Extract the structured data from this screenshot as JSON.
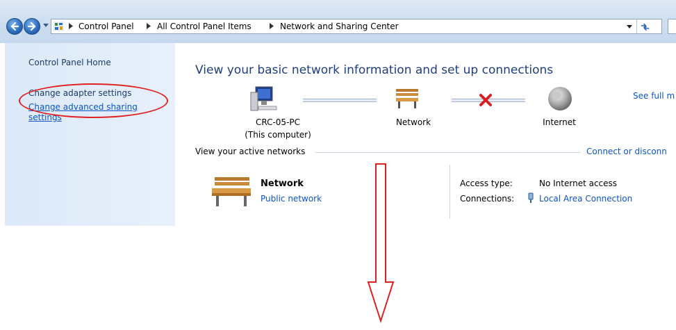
{
  "address_bar": {
    "crumbs": [
      "Control Panel",
      "All Control Panel Items",
      "Network and Sharing Center"
    ]
  },
  "sidebar": {
    "home": "Control Panel Home",
    "adapter": "Change adapter settings",
    "advanced_line1": "Change advanced sharing",
    "advanced_line2": "settings"
  },
  "main": {
    "title": "View your basic network information and set up connections",
    "see_full_map": "See full m",
    "map": {
      "computer_name": "CRC-05-PC",
      "computer_sub": "(This computer)",
      "network": "Network",
      "internet": "Internet"
    },
    "active_networks_header": "View your active networks",
    "connect_link": "Connect or disconn",
    "network": {
      "name": "Network",
      "type": "Public network",
      "access_type_label": "Access type:",
      "access_type_value": "No Internet access",
      "connections_label": "Connections:",
      "connections_value": "Local Area Connection"
    }
  },
  "colors": {
    "link": "#0b55c4",
    "title": "#1e3f7a",
    "annotation": "#e02020"
  },
  "icons": [
    "back-icon",
    "forward-icon",
    "control-panel-icon",
    "dropdown-icon",
    "refresh-icon",
    "computer-icon",
    "bench-network-icon",
    "error-x-icon",
    "globe-icon",
    "ethernet-icon"
  ]
}
